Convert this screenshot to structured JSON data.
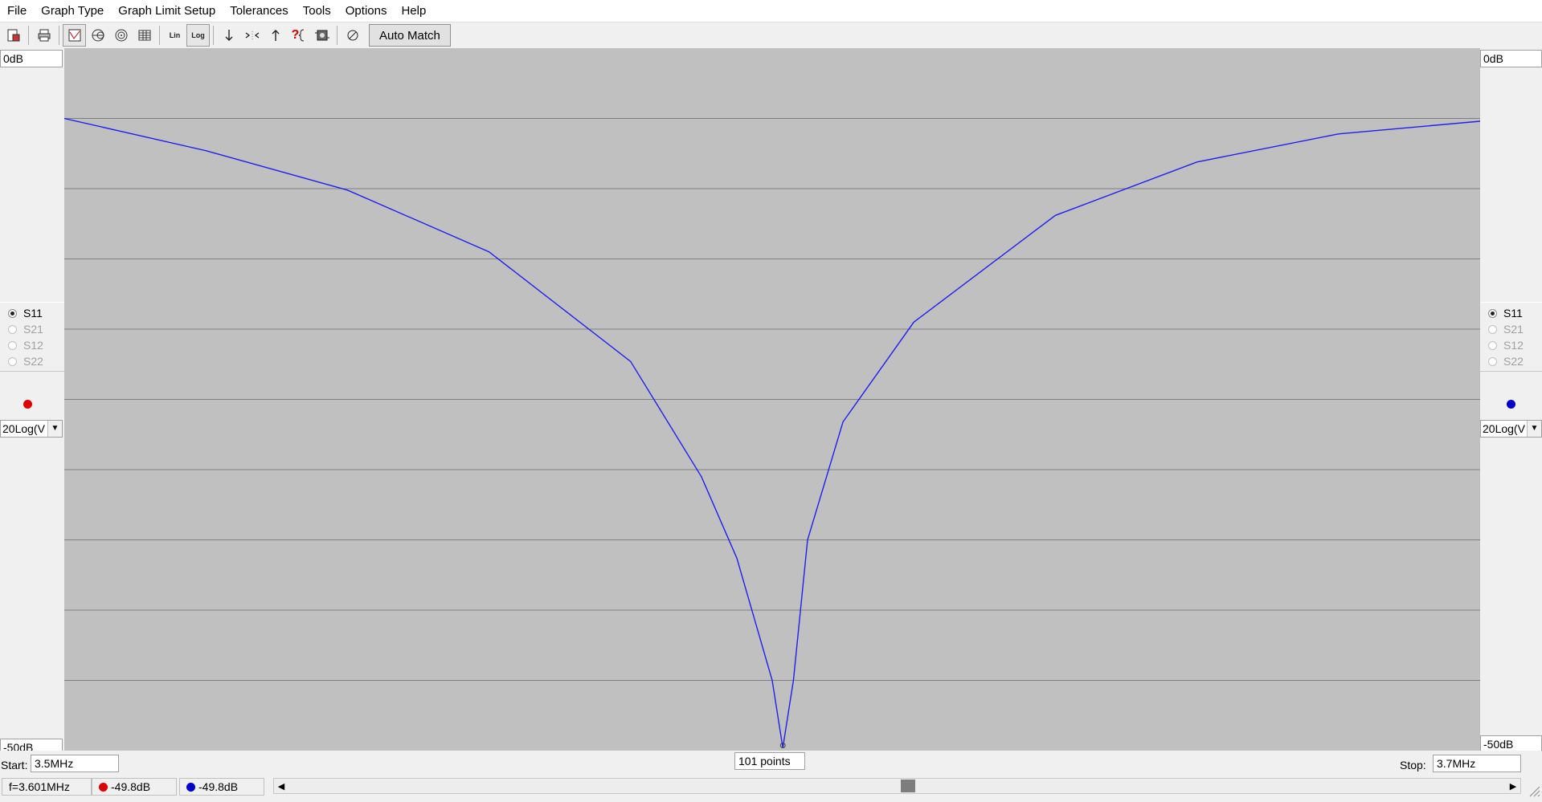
{
  "menu": [
    "File",
    "Graph Type",
    "Graph Limit Setup",
    "Tolerances",
    "Tools",
    "Options",
    "Help"
  ],
  "toolbar": {
    "lin_label": "Lin",
    "log_label": "Log",
    "help_label": "?",
    "auto_match": "Auto Match",
    "icons": [
      "file-save-icon",
      "print-icon",
      "rect-graph-icon",
      "smith-chart-icon",
      "polar-chart-icon",
      "table-icon",
      "linear-scale-icon",
      "log-scale-icon",
      "arrow-down-icon",
      "zoom-in-icon",
      "arrow-up-icon",
      "help-icon",
      "component-icon",
      "reset-icon"
    ]
  },
  "left_axis": {
    "top_limit": "0dB",
    "bottom_limit": "-50dB",
    "params": [
      {
        "label": "S11",
        "checked": true,
        "enabled": true
      },
      {
        "label": "S21",
        "checked": false,
        "enabled": false
      },
      {
        "label": "S12",
        "checked": false,
        "enabled": false
      },
      {
        "label": "S22",
        "checked": false,
        "enabled": false
      }
    ],
    "marker_color": "#e00000",
    "format": "20Log(V"
  },
  "right_axis": {
    "top_limit": "0dB",
    "bottom_limit": "-50dB",
    "params": [
      {
        "label": "S11",
        "checked": true,
        "enabled": true
      },
      {
        "label": "S21",
        "checked": false,
        "enabled": false
      },
      {
        "label": "S12",
        "checked": false,
        "enabled": false
      },
      {
        "label": "S22",
        "checked": false,
        "enabled": false
      }
    ],
    "marker_color": "#0000cc",
    "format": "20Log(V"
  },
  "sweep": {
    "start_label": "Start:",
    "start_value": "3.5MHz",
    "stop_label": "Stop:",
    "stop_value": "3.7MHz",
    "points": "101 points"
  },
  "status": {
    "frequency": "f=3.601MHz",
    "left_value": "-49.8dB",
    "right_value": "-49.8dB"
  },
  "chart_data": {
    "type": "line",
    "title": "",
    "xlabel": "",
    "ylabel": "",
    "xlim": [
      3.5,
      3.7
    ],
    "ylim": [
      -50,
      0
    ],
    "grid_y": true,
    "grid_x": false,
    "background": "#c0c0c0",
    "series": [
      {
        "color": "#2020ee",
        "x": [
          3.5,
          3.52,
          3.54,
          3.56,
          3.58,
          3.59,
          3.595,
          3.6,
          3.6015,
          3.603,
          3.605,
          3.61,
          3.62,
          3.64,
          3.66,
          3.68,
          3.7
        ],
        "y": [
          -5.0,
          -7.3,
          -10.1,
          -14.5,
          -22.3,
          -30.5,
          -36.3,
          -45.0,
          -49.8,
          -45.0,
          -35.0,
          -26.6,
          -19.5,
          -11.9,
          -8.1,
          -6.1,
          -5.2
        ]
      }
    ]
  }
}
